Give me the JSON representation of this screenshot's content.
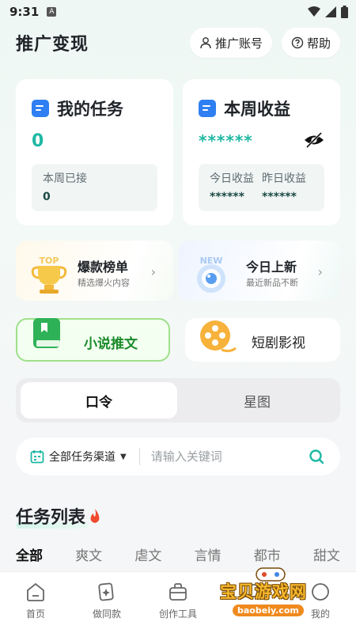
{
  "status_bar": {
    "time": "9:31",
    "badge": "A"
  },
  "header": {
    "title": "推广变现",
    "account_btn": "推广账号",
    "help_btn": "帮助"
  },
  "tasks_card": {
    "title": "我的任务",
    "total": "0",
    "week_label": "本周已接",
    "week_value": "0"
  },
  "earnings_card": {
    "title": "本周收益",
    "total": "******",
    "today_label": "今日收益",
    "today_value": "******",
    "yesterday_label": "昨日收益",
    "yesterday_value": "******"
  },
  "promos": [
    {
      "title": "爆款榜单",
      "subtitle": "精选爆火内容",
      "art": "TOP"
    },
    {
      "title": "今日上新",
      "subtitle": "最近新品不断",
      "art": "NEW"
    }
  ],
  "categories": {
    "novel": "小说推文",
    "short_drama": "短剧影视"
  },
  "segment": {
    "active": "口令",
    "inactive": "星图"
  },
  "search": {
    "channel": "全部任务渠道",
    "placeholder": "请输入关键词"
  },
  "task_list": {
    "title": "任务列表",
    "genres": [
      "全部",
      "爽文",
      "虐文",
      "言情",
      "都市",
      "甜文"
    ]
  },
  "tabbar": [
    "首页",
    "做同款",
    "创作工具",
    "",
    "我的"
  ],
  "watermark": {
    "text": "宝贝游戏网",
    "url": "baobeiy.com"
  },
  "colors": {
    "accent": "#1fb8a3",
    "novel_green": "#1b8b2a"
  }
}
